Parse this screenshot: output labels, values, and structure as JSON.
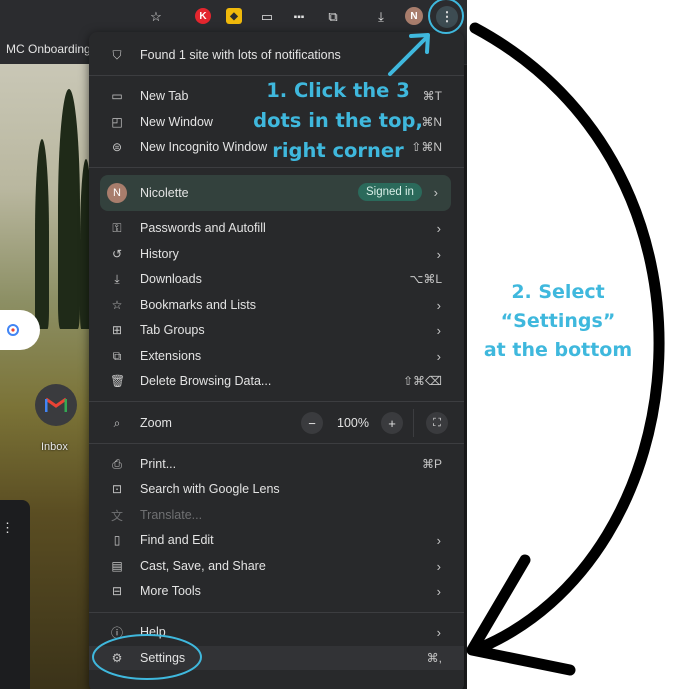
{
  "bookmarks_bar": {
    "item": "MC Onboarding"
  },
  "toolbar": {
    "extension_k": "K",
    "extension_bin": "◆",
    "profile_initial": "N"
  },
  "menu": {
    "notification_notice": "Found 1 site with lots of notifications",
    "new_tab": {
      "label": "New Tab",
      "shortcut": "⌘T"
    },
    "new_window": {
      "label": "New Window",
      "shortcut": "⌘N"
    },
    "new_incognito": {
      "label": "New Incognito Window",
      "shortcut": "⇧⌘N"
    },
    "profile": {
      "initial": "N",
      "name": "Nicolette",
      "status": "Signed in"
    },
    "passwords": {
      "label": "Passwords and Autofill"
    },
    "history": {
      "label": "History"
    },
    "downloads": {
      "label": "Downloads",
      "shortcut": "⌥⌘L"
    },
    "bookmarks": {
      "label": "Bookmarks and Lists"
    },
    "tab_groups": {
      "label": "Tab Groups"
    },
    "extensions": {
      "label": "Extensions"
    },
    "delete_data": {
      "label": "Delete Browsing Data...",
      "shortcut": "⇧⌘⌫"
    },
    "zoom": {
      "label": "Zoom",
      "minus": "−",
      "level": "100%",
      "plus": "+"
    },
    "print": {
      "label": "Print...",
      "shortcut": "⌘P"
    },
    "lens": {
      "label": "Search with Google Lens"
    },
    "translate": {
      "label": "Translate..."
    },
    "find_edit": {
      "label": "Find and Edit"
    },
    "cast_save": {
      "label": "Cast, Save, and Share"
    },
    "more_tools": {
      "label": "More Tools"
    },
    "help": {
      "label": "Help"
    },
    "settings": {
      "label": "Settings",
      "shortcut": "⌘,"
    }
  },
  "page": {
    "inbox_label": "Inbox"
  },
  "annotations": {
    "step1": [
      "1. Click the 3",
      "dots in the top,",
      "right corner"
    ],
    "step2": [
      "2. Select",
      "“Settings”",
      "at the bottom"
    ]
  },
  "colors": {
    "annotation": "#3fb8dd",
    "menu_bg": "#28292b",
    "signed_in_badge": "#2b6a5b"
  }
}
